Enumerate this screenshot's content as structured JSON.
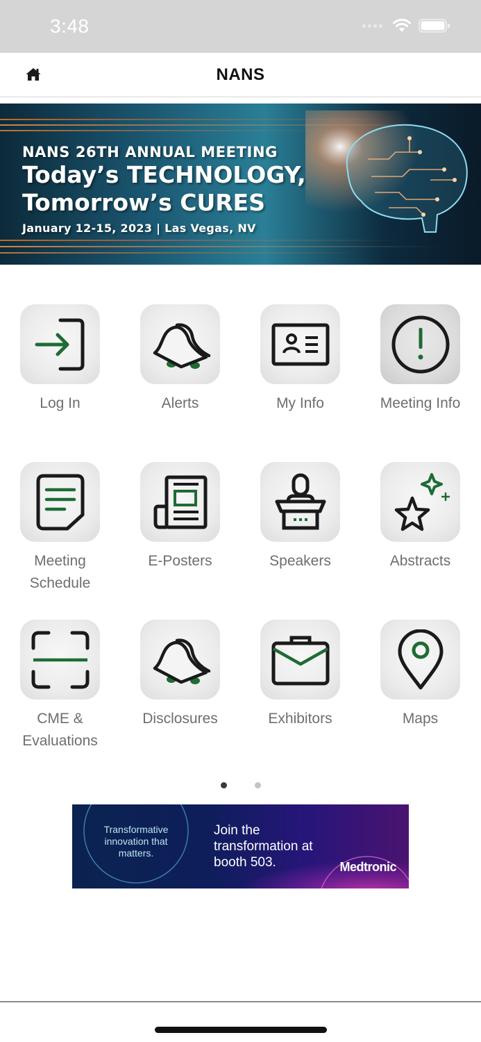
{
  "status_bar": {
    "time": "3:48",
    "icons": [
      "signal-icon",
      "wifi-icon",
      "battery-icon"
    ]
  },
  "nav": {
    "title": "NANS",
    "home_icon": "home-icon"
  },
  "banner": {
    "kicker": "NANS 26TH ANNUAL MEETING",
    "headline_line1": "Today’s TECHNOLOGY,",
    "headline_line2": "Tomorrow’s CURES",
    "dates": "January 12-15, 2023  |  Las Vegas, NV"
  },
  "tiles": [
    {
      "label": "Log In",
      "icon": "log-in-icon"
    },
    {
      "label": "Alerts",
      "icon": "bell-icon"
    },
    {
      "label": "My Info",
      "icon": "id-card-icon"
    },
    {
      "label": "Meeting Info",
      "icon": "info-icon"
    },
    {
      "label": "Meeting Schedule",
      "icon": "document-icon"
    },
    {
      "label": "E-Posters",
      "icon": "newspaper-icon"
    },
    {
      "label": "Speakers",
      "icon": "podium-icon"
    },
    {
      "label": "Abstracts",
      "icon": "star-icon"
    },
    {
      "label": "CME & Evaluations",
      "icon": "scan-icon"
    },
    {
      "label": "Disclosures",
      "icon": "bell-icon"
    },
    {
      "label": "Exhibitors",
      "icon": "briefcase-icon"
    },
    {
      "label": "Maps",
      "icon": "map-pin-icon"
    }
  ],
  "pager": {
    "pages": 2,
    "current": 1
  },
  "ad": {
    "tagline": "Transformative innovation that matters.",
    "message": "Join the transformation at booth 503.",
    "brand": "Medtronic"
  },
  "colors": {
    "accent_green": "#1f6b34",
    "icon_stroke": "#1a1a1a",
    "label_gray": "#6e6e6e",
    "status_bar_bg": "#d5d5d5"
  }
}
